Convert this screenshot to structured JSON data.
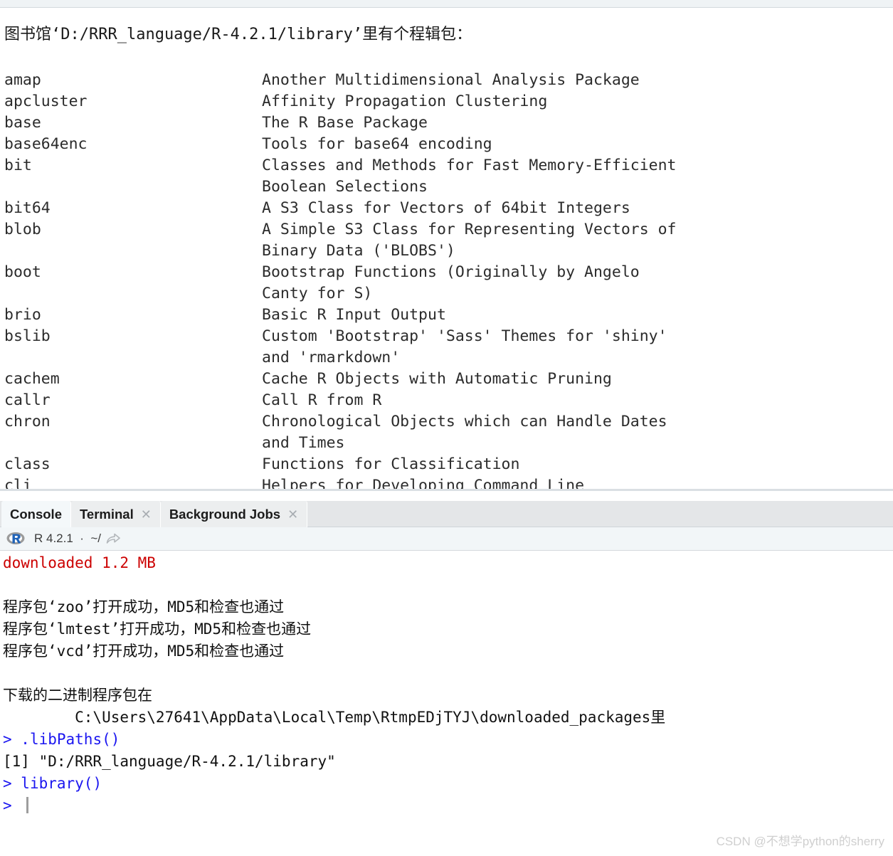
{
  "help_pane": {
    "title": "图书馆‘D:/RRR_language/R-4.2.1/library’里有个程辑包：",
    "packages": [
      {
        "name": "amap",
        "desc": [
          "Another Multidimensional Analysis Package"
        ]
      },
      {
        "name": "apcluster",
        "desc": [
          "Affinity Propagation Clustering"
        ]
      },
      {
        "name": "base",
        "desc": [
          "The R Base Package"
        ]
      },
      {
        "name": "base64enc",
        "desc": [
          "Tools for base64 encoding"
        ]
      },
      {
        "name": "bit",
        "desc": [
          "Classes and Methods for Fast Memory-Efficient",
          "Boolean Selections"
        ]
      },
      {
        "name": "bit64",
        "desc": [
          "A S3 Class for Vectors of 64bit Integers"
        ]
      },
      {
        "name": "blob",
        "desc": [
          "A Simple S3 Class for Representing Vectors of",
          "Binary Data ('BLOBS')"
        ]
      },
      {
        "name": "boot",
        "desc": [
          "Bootstrap Functions (Originally by Angelo",
          "Canty for S)"
        ]
      },
      {
        "name": "brio",
        "desc": [
          "Basic R Input Output"
        ]
      },
      {
        "name": "bslib",
        "desc": [
          "Custom 'Bootstrap' 'Sass' Themes for 'shiny'",
          "and 'rmarkdown'"
        ]
      },
      {
        "name": "cachem",
        "desc": [
          "Cache R Objects with Automatic Pruning"
        ]
      },
      {
        "name": "callr",
        "desc": [
          "Call R from R"
        ]
      },
      {
        "name": "chron",
        "desc": [
          "Chronological Objects which can Handle Dates",
          "and Times"
        ]
      },
      {
        "name": "class",
        "desc": [
          "Functions for Classification"
        ]
      },
      {
        "name": "cli",
        "desc": [
          "Helpers for Developing Command Line"
        ]
      }
    ]
  },
  "console_pane": {
    "tabs": [
      {
        "label": "Console",
        "active": true,
        "closable": false,
        "close_glyph": ""
      },
      {
        "label": "Terminal",
        "active": false,
        "closable": true,
        "close_glyph": "✕"
      },
      {
        "label": "Background Jobs",
        "active": false,
        "closable": true,
        "close_glyph": "✕"
      }
    ],
    "version_bar": {
      "logo_letter": "R",
      "text": "R 4.2.1  ·  ~/",
      "share_icon": "share-arrow-icon"
    },
    "output": [
      {
        "text": "downloaded 1.2 MB",
        "color": "red",
        "prompt": false
      },
      {
        "text": "",
        "color": "black",
        "prompt": false
      },
      {
        "text": "程序包‘zoo’打开成功，MD5和检查也通过",
        "color": "black",
        "prompt": false
      },
      {
        "text": "程序包‘lmtest’打开成功，MD5和检查也通过",
        "color": "black",
        "prompt": false
      },
      {
        "text": "程序包‘vcd’打开成功，MD5和检查也通过",
        "color": "black",
        "prompt": false
      },
      {
        "text": "",
        "color": "black",
        "prompt": false
      },
      {
        "text": "下载的二进制程序包在",
        "color": "black",
        "prompt": false
      },
      {
        "text": "        C:\\Users\\27641\\AppData\\Local\\Temp\\RtmpEDjTYJ\\downloaded_packages里",
        "color": "black",
        "prompt": false
      },
      {
        "text": ".libPaths()",
        "color": "blue",
        "prompt": true
      },
      {
        "text": "[1] \"D:/RRR_language/R-4.2.1/library\"",
        "color": "black",
        "prompt": false
      },
      {
        "text": "library()",
        "color": "blue",
        "prompt": true
      },
      {
        "text": "",
        "color": "blue",
        "prompt": true,
        "cursor": true
      }
    ]
  },
  "watermark": "CSDN @不想学python的sherry",
  "colors": {
    "error_red": "#cc0000",
    "command_blue": "#1b16f0",
    "tab_bar_bg": "#e4e6e8",
    "active_tab_bg": "#f4f8fa",
    "version_bar_bg": "#f2f6f8",
    "watermark_gray": "#cfcfcf"
  }
}
